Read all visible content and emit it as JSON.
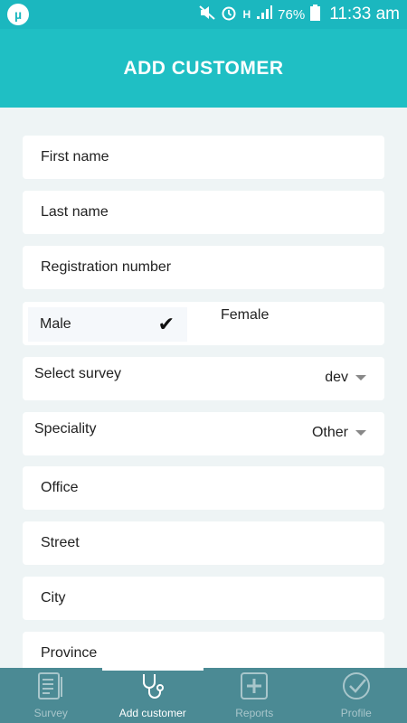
{
  "status_bar": {
    "app_icon": "µ",
    "battery": "76%",
    "time": "11:33 am"
  },
  "header": {
    "title": "ADD CUSTOMER"
  },
  "form": {
    "first_name": "First name",
    "last_name": "Last name",
    "registration_number": "Registration number",
    "gender": {
      "male": "Male",
      "female": "Female",
      "selected": "male"
    },
    "survey": {
      "label": "Select survey",
      "value": "dev"
    },
    "speciality": {
      "label": "Speciality",
      "value": "Other"
    },
    "office": "Office",
    "street": "Street",
    "city": "City",
    "province": "Province"
  },
  "bottom_nav": {
    "items": [
      {
        "label": "Survey",
        "icon": "clipboard-icon"
      },
      {
        "label": "Add customer",
        "icon": "stethoscope-icon",
        "active": true
      },
      {
        "label": "Reports",
        "icon": "plus-square-icon"
      },
      {
        "label": "Profile",
        "icon": "check-circle-icon"
      }
    ]
  }
}
